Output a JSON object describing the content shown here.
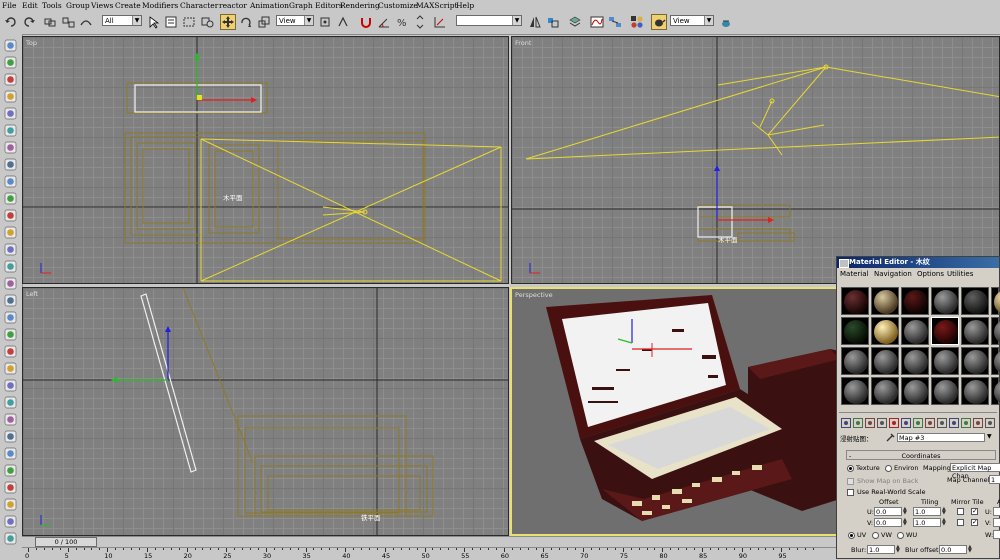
{
  "menu": [
    "File",
    "Edit",
    "Tools",
    "Group",
    "Views",
    "Create",
    "Modifiers",
    "Character",
    "reactor",
    "Animation",
    "Graph Editors",
    "Rendering",
    "Customize",
    "MAXScript",
    "Help"
  ],
  "toolbar": {
    "selection_filter": "All",
    "ref_coord": "View",
    "named_selection": "",
    "view_dropdown": "View"
  },
  "viewports": {
    "top": {
      "label": "Top",
      "object_label": "木平面"
    },
    "front": {
      "label": "Front",
      "object_label": "木平面"
    },
    "left": {
      "label": "Left",
      "object_label": "铁平面"
    },
    "perspective": {
      "label": "Perspective"
    }
  },
  "timeline": {
    "slider": "0 / 100",
    "ticks": [
      "0",
      "5",
      "10",
      "15",
      "20",
      "25",
      "30",
      "35",
      "40",
      "45",
      "50",
      "55",
      "60",
      "65",
      "70",
      "75",
      "80",
      "85",
      "90",
      "95"
    ]
  },
  "material_editor": {
    "title": "Material Editor - 木纹",
    "menu": [
      "Material",
      "Navigation",
      "Options",
      "Utilities"
    ],
    "map_name_label": "浸射贴图：",
    "map_name": "Map #3",
    "rollout": "Coordinates",
    "texture": "Texture",
    "environ": "Environ",
    "mapping_label": "Mapping:",
    "mapping_value": "Explicit Map Chan",
    "show_map_on_back": "Show Map on Back",
    "map_channel_label": "Map Channel:",
    "map_channel_value": "1",
    "use_real_world": "Use Real-World Scale",
    "offset": "Offset",
    "tiling": "Tiling",
    "mirror_tile": "Mirror Tile",
    "u_label": "U:",
    "v_label": "V:",
    "u_offset": "0.0",
    "v_offset": "0.0",
    "u_tiling": "1.0",
    "v_tiling": "1.0",
    "a_label": "A",
    "u_angle": "",
    "v_angle": "",
    "uv": "UV",
    "vw": "VW",
    "wu": "WU",
    "w_label": "W:",
    "w_angle": "",
    "blur_label": "Blur:",
    "blur_value": "1.0",
    "blur_offset_label": "Blur offset:",
    "blur_offset_value": "0.0"
  }
}
